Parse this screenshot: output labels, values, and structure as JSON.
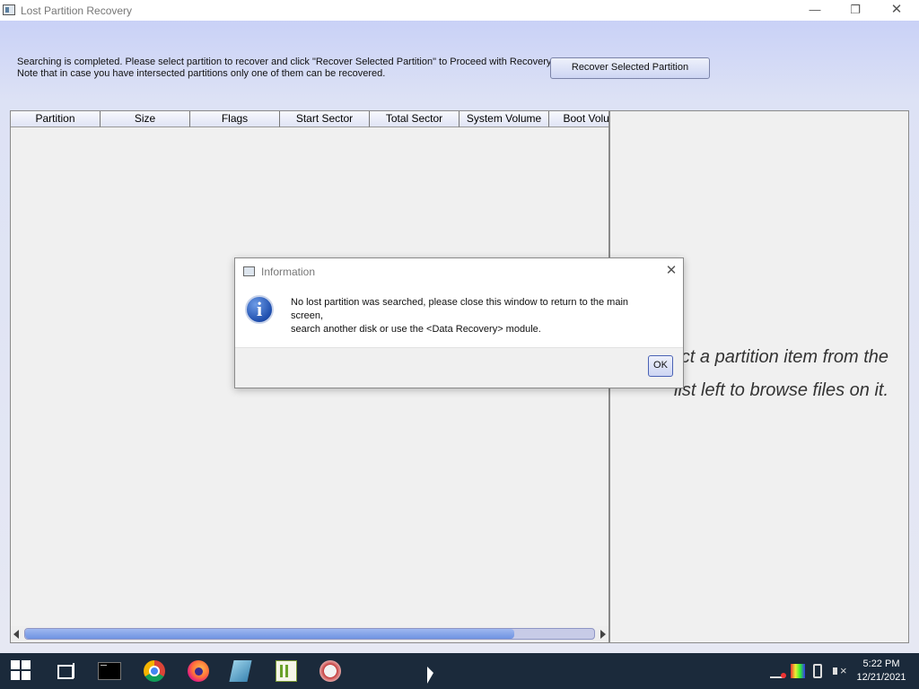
{
  "window": {
    "title": "Lost Partition Recovery",
    "minimize_glyph": "—",
    "maximize_glyph": "❐",
    "close_glyph": "✕"
  },
  "header": {
    "info_line1": "Searching is completed. Please select partition to recover and click \"Recover Selected Partition\" to Proceed with Recovery.",
    "info_line2": "Note that in case you have intersected partitions only one of them can be recovered.",
    "recover_button": "Recover Selected Partition"
  },
  "partition_list": {
    "columns": [
      "Partition",
      "Size",
      "Flags",
      "Start Sector",
      "Total Sector",
      "System Volume",
      "Boot Volume"
    ],
    "rows": [],
    "scroll_fraction": 0.86
  },
  "browse_panel": {
    "hint_line1": "Select a partition item from the",
    "hint_line2": "list left to browse files on it."
  },
  "dialog": {
    "title": "Information",
    "close_glyph": "✕",
    "icon": "info-icon",
    "icon_glyph": "i",
    "message_line1": "No lost partition was searched, please close this window to return to the main",
    "message_line2": "screen,",
    "message_line3": "search another disk or use the <Data Recovery> module.",
    "ok_button": "OK"
  },
  "taskbar": {
    "apps": [
      "start-icon",
      "task-view-icon",
      "command-prompt-icon",
      "chrome-icon",
      "firefox-icon",
      "notepad-icon",
      "text-editor-icon",
      "paint-icon"
    ],
    "tray_icons": [
      "network-icon",
      "color-icon",
      "usb-icon",
      "volume-muted-icon"
    ],
    "time": "5:22 PM",
    "date": "12/21/2021"
  },
  "colors": {
    "accent": "#6f93e2",
    "header_gradient_top": "#c9d1f6",
    "taskbar_bg": "#1b2a3b",
    "info_icon_blue": "#1f4fae"
  }
}
